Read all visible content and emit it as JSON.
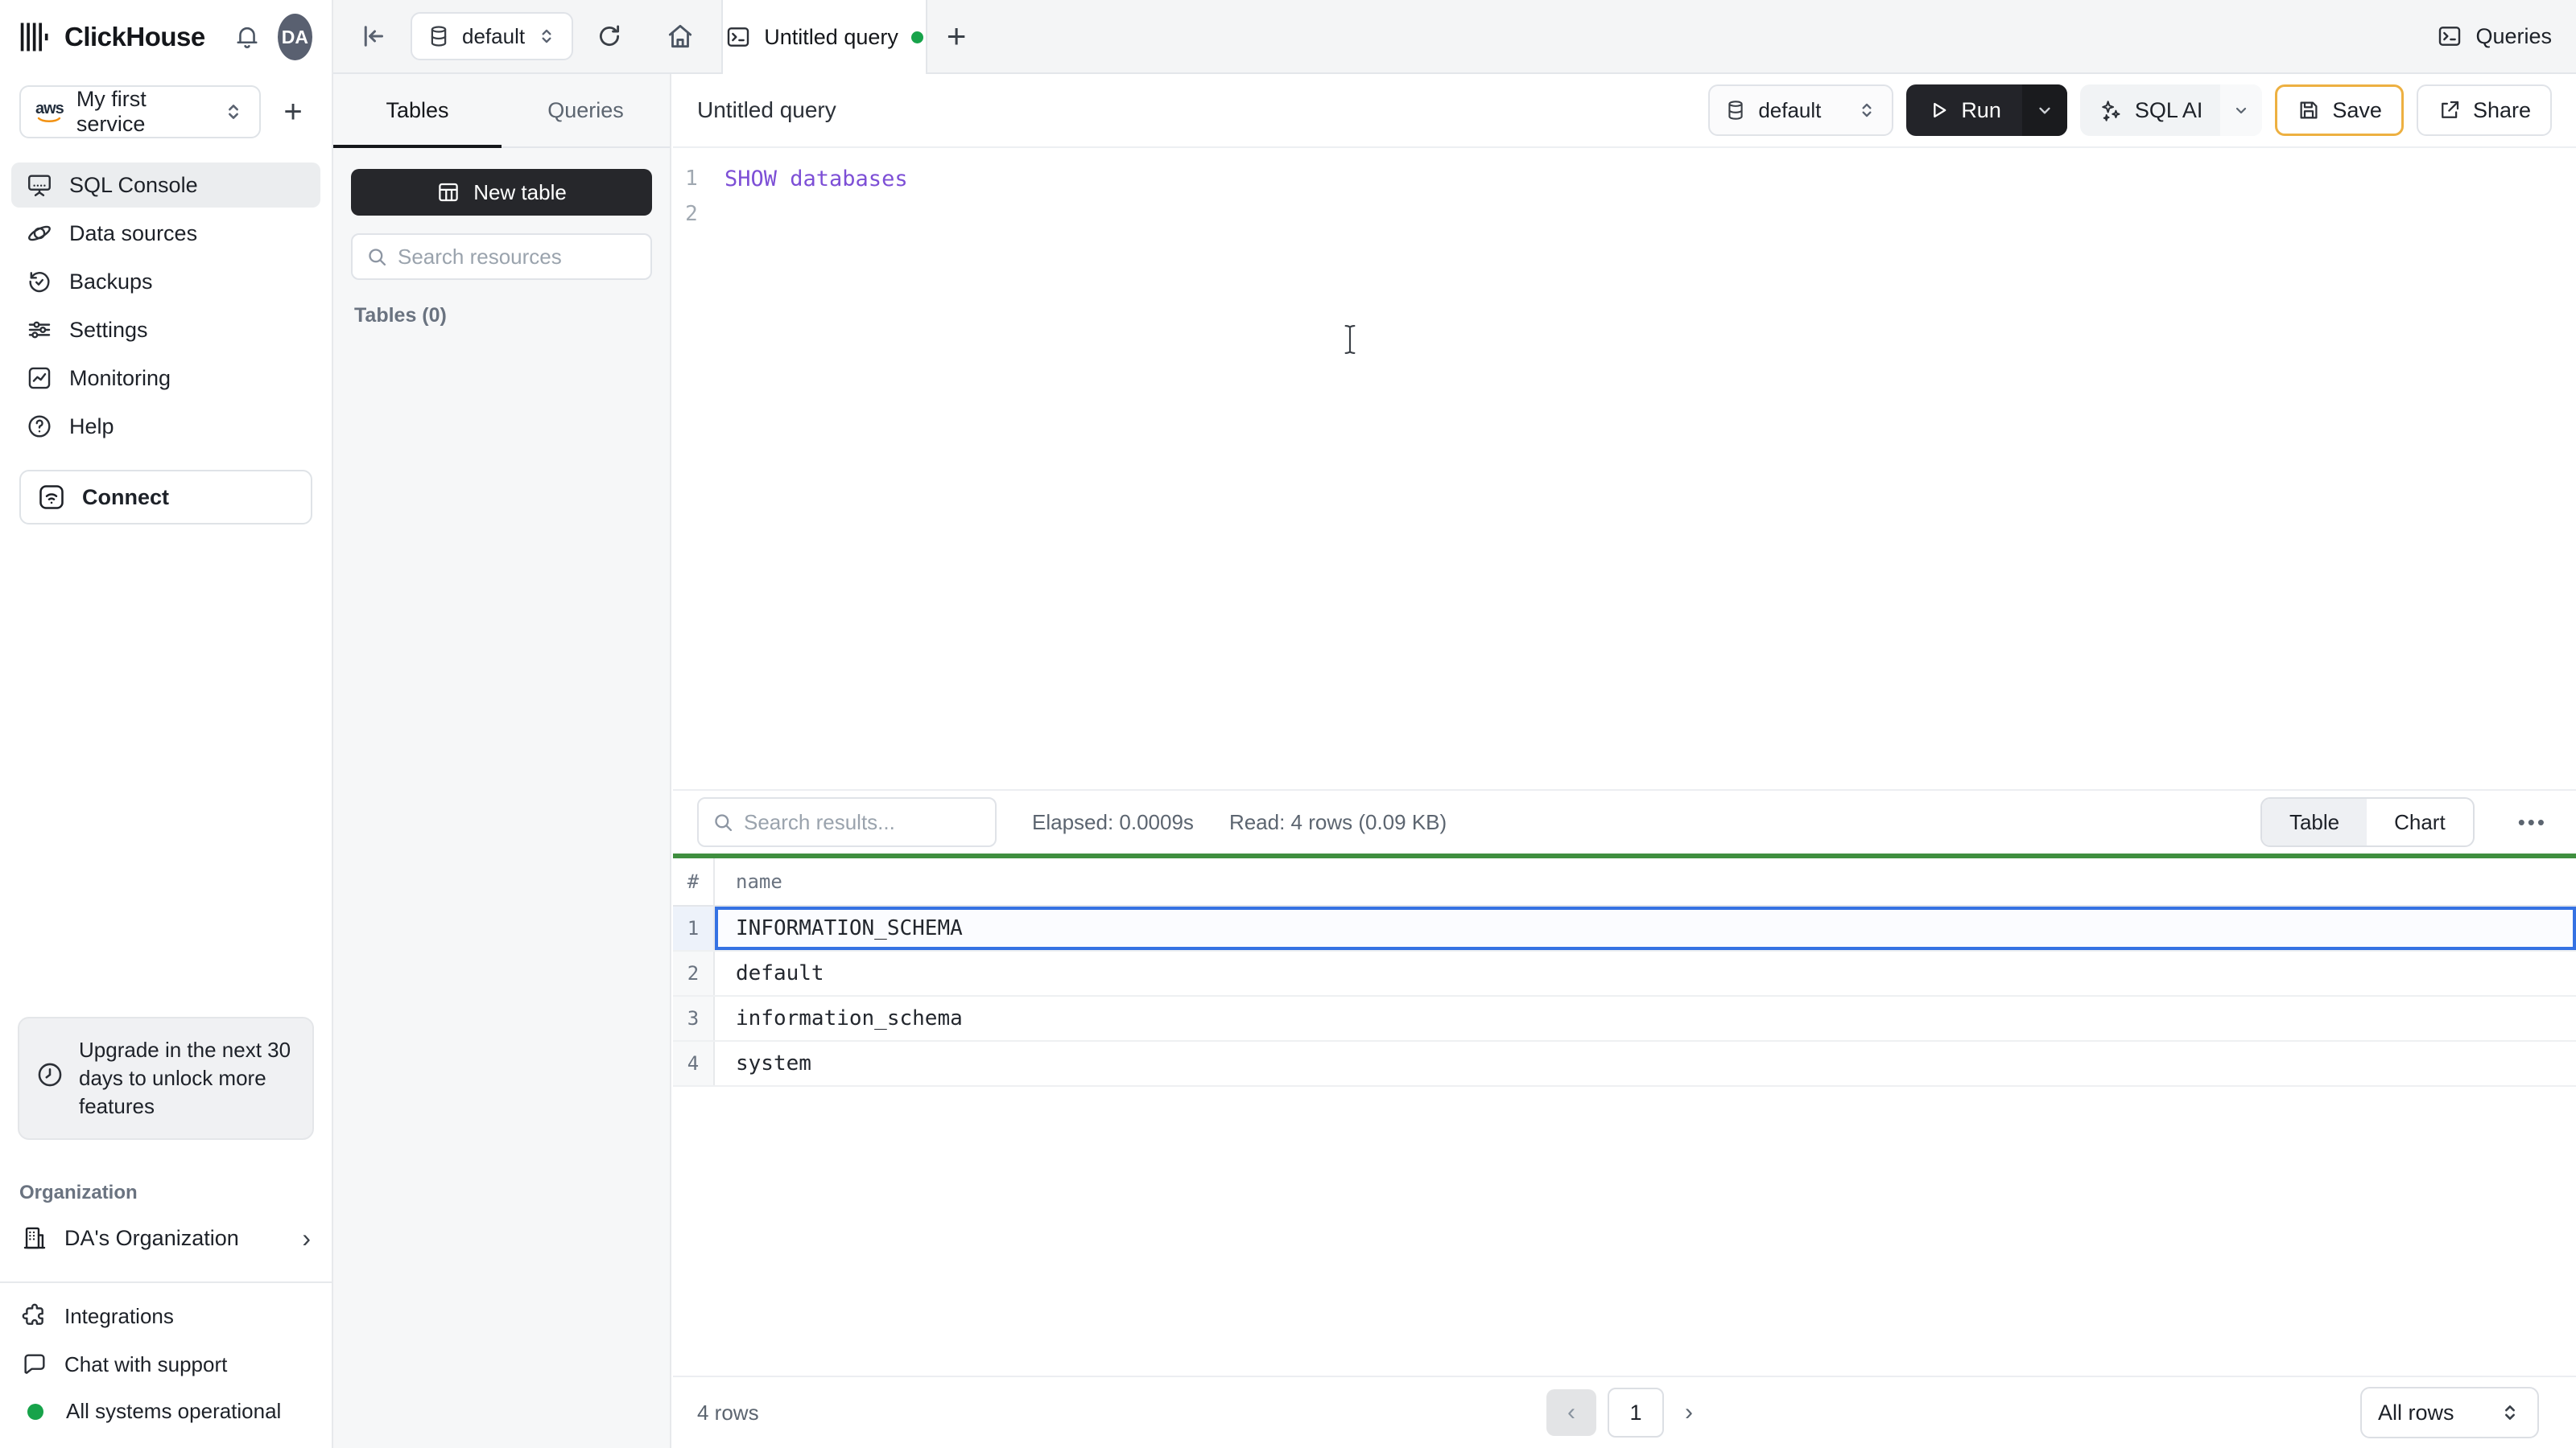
{
  "brand": {
    "name": "ClickHouse",
    "avatar_initials": "DA"
  },
  "topstrip": {
    "database_selector": "default",
    "tab_title": "Untitled query",
    "queries_button": "Queries"
  },
  "sidebar": {
    "service": {
      "name": "My first service",
      "provider": "aws"
    },
    "nav": [
      {
        "label": "SQL Console",
        "active": true
      },
      {
        "label": "Data sources",
        "active": false
      },
      {
        "label": "Backups",
        "active": false
      },
      {
        "label": "Settings",
        "active": false
      },
      {
        "label": "Monitoring",
        "active": false
      },
      {
        "label": "Help",
        "active": false
      }
    ],
    "connect_label": "Connect",
    "upgrade_notice": "Upgrade in the next 30 days to unlock more features",
    "organization_heading": "Organization",
    "organization_name": "DA's Organization",
    "integrations_label": "Integrations",
    "chat_label": "Chat with support",
    "status_label": "All systems operational"
  },
  "explorer": {
    "tab_tables": "Tables",
    "tab_queries": "Queries",
    "new_table_label": "New table",
    "search_placeholder": "Search resources",
    "tables_count": "Tables (0)"
  },
  "editor": {
    "title": "Untitled query",
    "database_selector": "default",
    "run_label": "Run",
    "sql_ai_label": "SQL AI",
    "save_label": "Save",
    "share_label": "Share",
    "line1_number": "1",
    "line1_code": "SHOW databases",
    "line2_number": "2"
  },
  "results": {
    "search_placeholder": "Search results...",
    "elapsed": "Elapsed: 0.0009s",
    "read": "Read: 4 rows (0.09 KB)",
    "toggle_table": "Table",
    "toggle_chart": "Chart",
    "columns": [
      "#",
      "name"
    ],
    "rows": [
      {
        "n": "1",
        "name": "INFORMATION_SCHEMA",
        "selected": true
      },
      {
        "n": "2",
        "name": "default",
        "selected": false
      },
      {
        "n": "3",
        "name": "information_schema",
        "selected": false
      },
      {
        "n": "4",
        "name": "system",
        "selected": false
      }
    ],
    "footer_rows": "4 rows",
    "page": "1",
    "page_size": "All rows"
  },
  "glyphs": {
    "plus": "+",
    "chevron_right": "›",
    "page_prev": "‹",
    "page_next": "›",
    "more": "•••"
  },
  "colors": {
    "green": "#17a34a",
    "purple": "#7d4fd6",
    "sel_blue": "#3572e3",
    "save_border": "#edb041",
    "divider_green": "#3f8f3f"
  }
}
